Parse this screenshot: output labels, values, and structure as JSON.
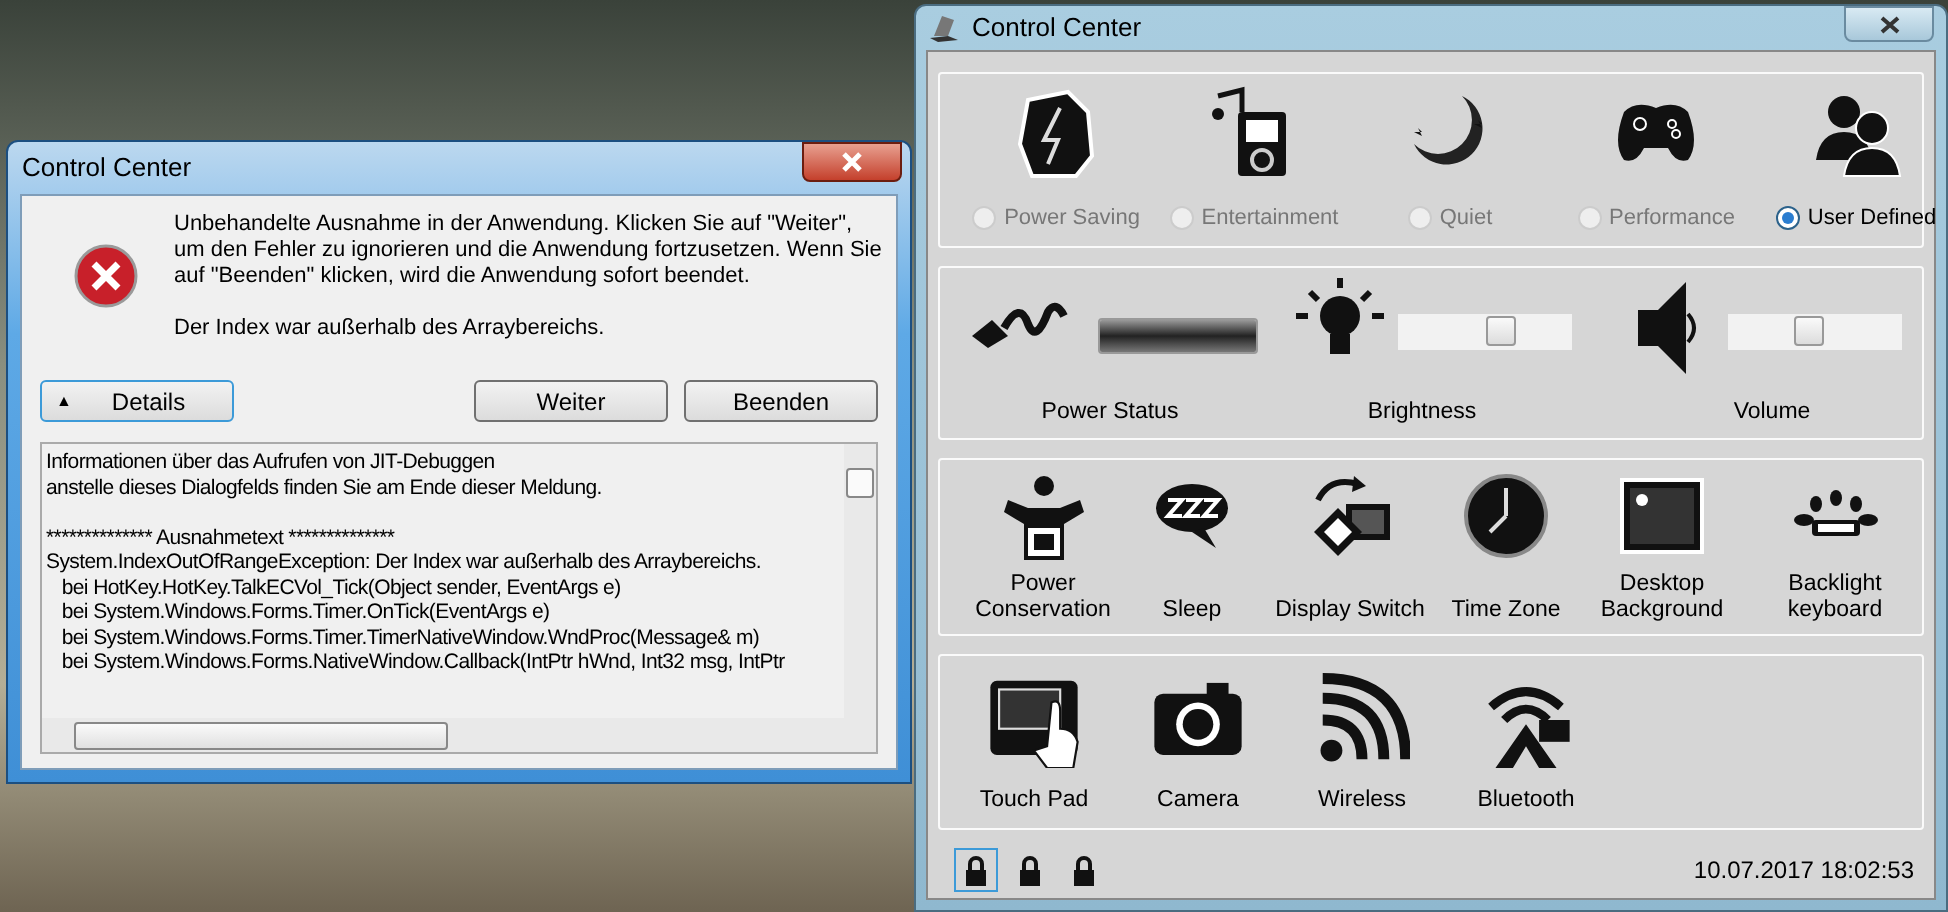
{
  "error_dialog": {
    "title": "Control Center",
    "message": "Unbehandelte Ausnahme in der Anwendung. Klicken Sie auf \"Weiter\", um den Fehler zu ignorieren und die Anwendung fortzusetzen. Wenn Sie auf \"Beenden\" klicken, wird die Anwendung sofort beendet.",
    "detail_message": "Der Index war außerhalb des Arraybereichs.",
    "details_button": {
      "icon": "▲",
      "label": "Details"
    },
    "buttons": [
      "Weiter",
      "Beenden"
    ],
    "details_blocks": [
      [
        "Informationen über das Aufrufen von JIT-Debuggen",
        "anstelle dieses Dialogfelds finden Sie am Ende dieser Meldung."
      ],
      [
        "************** Ausnahmetext **************",
        "System.IndexOutOfRangeException: Der Index war außerhalb des Arraybereichs.",
        "   bei HotKey.HotKey.TalkECVol_Tick(Object sender, EventArgs e)",
        "   bei System.Windows.Forms.Timer.OnTick(EventArgs e)",
        "   bei System.Windows.Forms.Timer.TimerNativeWindow.WndProc(Message& m)",
        "   bei System.Windows.Forms.NativeWindow.Callback(IntPtr hWnd, Int32 msg, IntPtr"
      ]
    ]
  },
  "control_center": {
    "title": "Control Center",
    "modes": [
      {
        "label": "Power Saving",
        "selected": false
      },
      {
        "label": "Entertainment",
        "selected": false
      },
      {
        "label": "Quiet",
        "selected": false
      },
      {
        "label": "Performance",
        "selected": false
      },
      {
        "label": "User Defined",
        "selected": true
      }
    ],
    "power_status": {
      "label": "Power Status",
      "level": 1
    },
    "brightness": {
      "label": "Brightness",
      "level": 0.62
    },
    "volume": {
      "label": "Volume",
      "level": 0.45
    },
    "tools": [
      "Power Conservation",
      "Sleep",
      "Display Switch",
      "Time Zone",
      "Desktop Background",
      "Backlight keyboard"
    ],
    "devices": [
      "Touch Pad",
      "Camera",
      "Wireless",
      "Bluetooth"
    ],
    "locks": [
      {
        "selected": true
      },
      {
        "selected": false
      },
      {
        "selected": false
      }
    ],
    "datetime": "10.07.2017 18:02:53"
  }
}
